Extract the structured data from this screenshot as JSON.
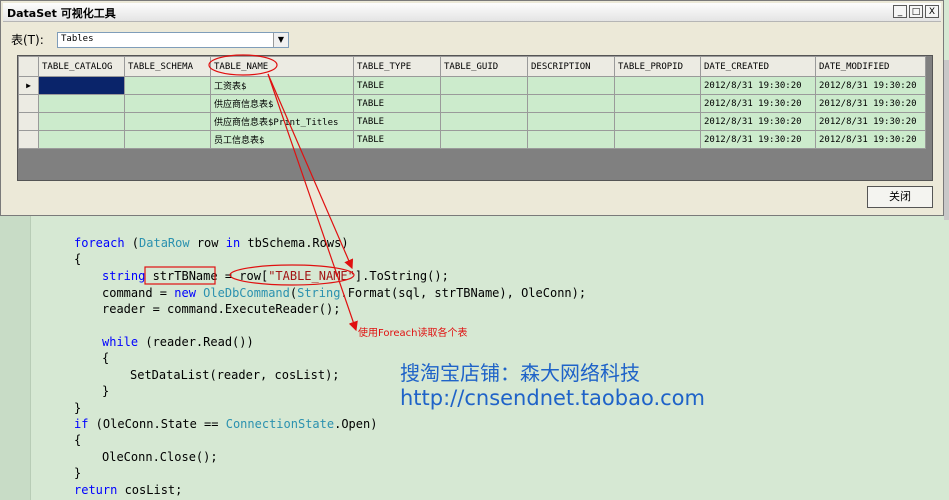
{
  "window": {
    "title": "DataSet 可视化工具",
    "min": "_",
    "max": "□",
    "close": "X",
    "table_label": "表(T):",
    "table_select": "Tables",
    "close_button": "关闭"
  },
  "grid": {
    "columns": [
      "TABLE_CATALOG",
      "TABLE_SCHEMA",
      "TABLE_NAME",
      "TABLE_TYPE",
      "TABLE_GUID",
      "DESCRIPTION",
      "TABLE_PROPID",
      "DATE_CREATED",
      "DATE_MODIFIED"
    ],
    "rows": [
      [
        "",
        "",
        "工资表$",
        "TABLE",
        "",
        "",
        "",
        "2012/8/31 19:30:20",
        "2012/8/31 19:30:20"
      ],
      [
        "",
        "",
        "供应商信息表$",
        "TABLE",
        "",
        "",
        "",
        "2012/8/31 19:30:20",
        "2012/8/31 19:30:20"
      ],
      [
        "",
        "",
        "供应商信息表$Print_Titles",
        "TABLE",
        "",
        "",
        "",
        "2012/8/31 19:30:20",
        "2012/8/31 19:30:20"
      ],
      [
        "",
        "",
        "员工信息表$",
        "TABLE",
        "",
        "",
        "",
        "2012/8/31 19:30:20",
        "2012/8/31 19:30:20"
      ]
    ]
  },
  "code": {
    "l1": [
      "foreach",
      " (",
      "DataRow",
      " row ",
      "in",
      " tbSchema.Rows)"
    ],
    "l2": "{",
    "l3": [
      "string",
      " strTBName = row[",
      "\"TABLE_NAME\"",
      "].ToString();"
    ],
    "l4": [
      "command = ",
      "new",
      " ",
      "OleDbCommand",
      "(",
      "String",
      ".Format(sql, strTBName), OleConn);"
    ],
    "l5": "reader = command.ExecuteReader();",
    "l6": [
      "while",
      " (reader.Read())"
    ],
    "l7": "{",
    "l8": "SetDataList(reader, cosList);",
    "l9": "}",
    "l10": "}",
    "l11": [
      "if",
      " (OleConn.State == ",
      "ConnectionState",
      ".Open)"
    ],
    "l12": "{",
    "l13": "OleConn.Close();",
    "l14": "}",
    "l15": [
      "return",
      " cosList;"
    ]
  },
  "annotation": "使用Foreach读取各个表",
  "watermark": {
    "line1": "搜淘宝店铺：森大网络科技",
    "line2": "http://cnsendnet.taobao.com"
  }
}
